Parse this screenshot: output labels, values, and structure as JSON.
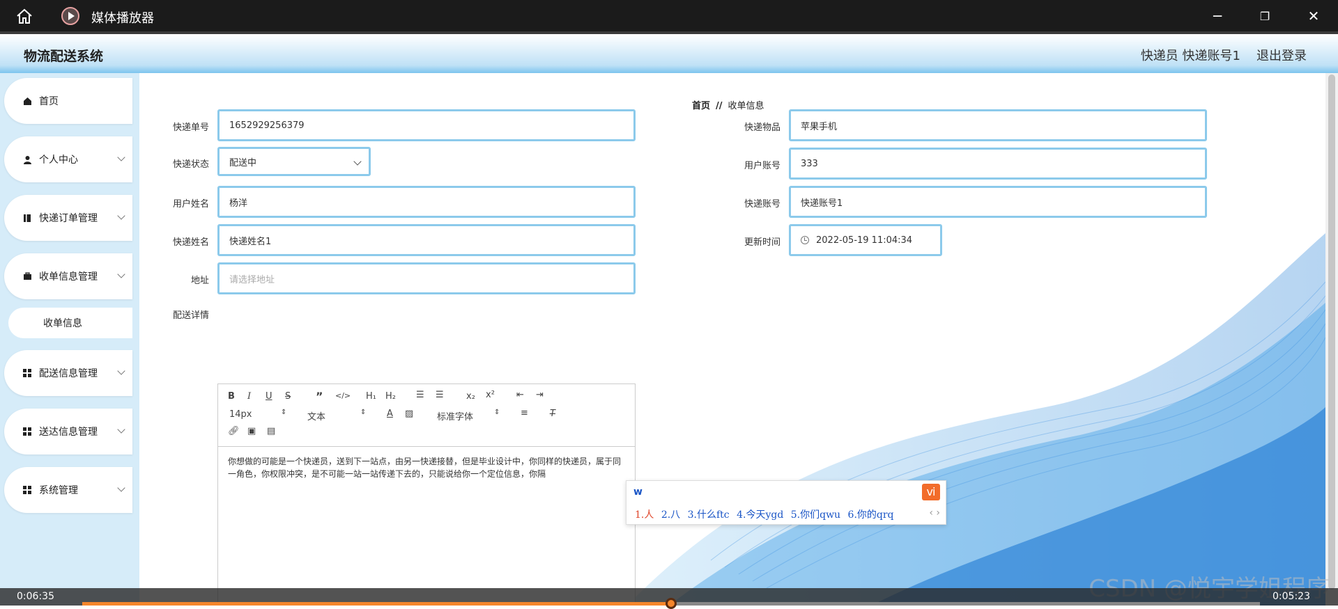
{
  "titlebar": {
    "title": "媒体播放器",
    "minimize": "─",
    "restore": "❐",
    "close": "✕"
  },
  "header": {
    "system_title": "物流配送系统",
    "user": "快递员 快递账号1",
    "logout": "退出登录"
  },
  "sidebar": {
    "items": [
      {
        "label": "首页",
        "icon": "home-icon"
      },
      {
        "label": "个人中心",
        "icon": "user-icon"
      },
      {
        "label": "快递订单管理",
        "icon": "book-icon"
      },
      {
        "label": "收单信息管理",
        "icon": "briefcase-icon"
      },
      {
        "label": "配送信息管理",
        "icon": "grid-icon"
      },
      {
        "label": "送达信息管理",
        "icon": "grid-icon"
      },
      {
        "label": "系统管理",
        "icon": "grid-icon"
      }
    ],
    "subitem": "收单信息"
  },
  "breadcrumb": {
    "home": "首页",
    "sep": "//",
    "current": "收单信息"
  },
  "form": {
    "tracking_no": {
      "label": "快递单号",
      "value": "1652929256379"
    },
    "item": {
      "label": "快递物品",
      "value": "苹果手机"
    },
    "status": {
      "label": "快递状态",
      "value": "配送中"
    },
    "user_account": {
      "label": "用户账号",
      "value": "333"
    },
    "user_name": {
      "label": "用户姓名",
      "value": "杨洋"
    },
    "courier_account": {
      "label": "快递账号",
      "value": "快递账号1"
    },
    "courier_name": {
      "label": "快递姓名",
      "value": "快递姓名1"
    },
    "update_time": {
      "label": "更新时间",
      "value": "2022-05-19 11:04:34"
    },
    "address": {
      "label": "地址",
      "placeholder": "请选择地址"
    },
    "details": {
      "label": "配送详情"
    }
  },
  "editor": {
    "font_size": "14px",
    "text_style": "文本",
    "font_family": "标准字体",
    "content": "你想做的可能是一个快递员，送到下一站点，由另一快递接替，但是毕业设计中，你同样的快递员，属于同一角色，你权限冲突，是不可能一站一站传递下去的，只能说给你一个定位信息，你隔"
  },
  "ime": {
    "input": "w",
    "candidates": [
      "1.人",
      "2.八",
      "3.什么ftc",
      "4.今天ygd",
      "5.你们qwu",
      "6.你的qrq"
    ]
  },
  "player": {
    "elapsed": "0:06:35",
    "total": "0:05:23",
    "progress": 0.5
  },
  "watermark": "CSDN @悦宇学姐程序"
}
